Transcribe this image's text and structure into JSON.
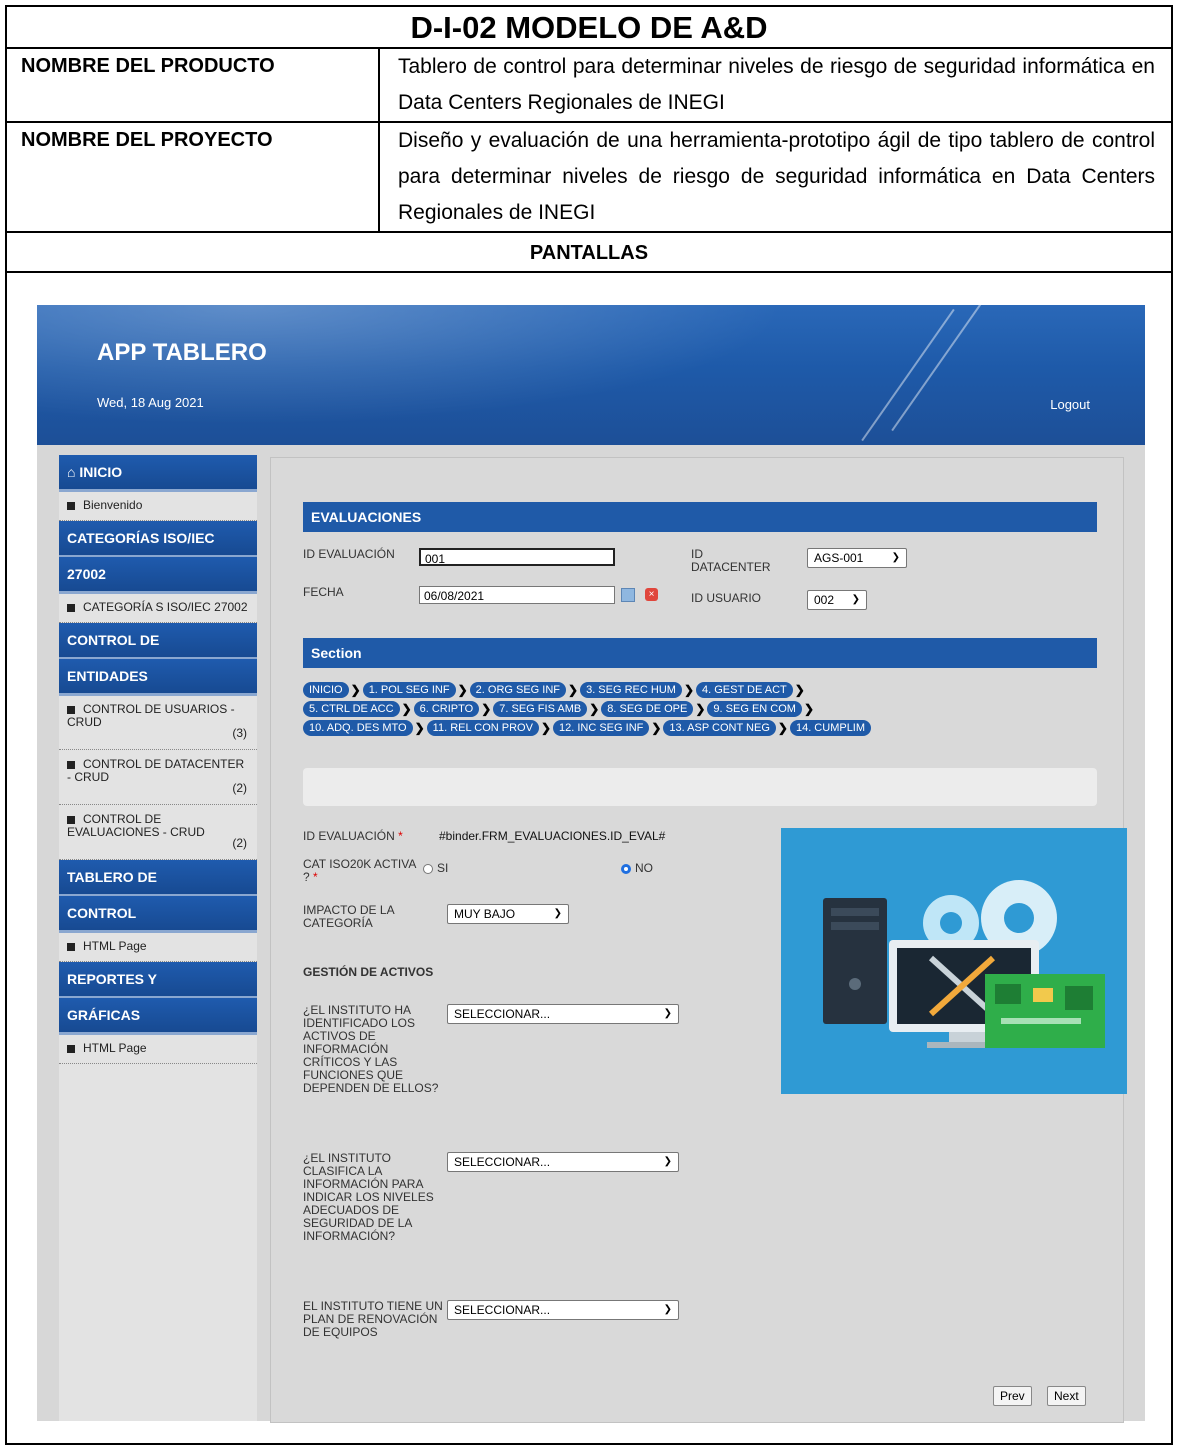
{
  "doc": {
    "title": "D-I-02 MODELO DE A&D",
    "rows": [
      {
        "label": "NOMBRE DEL PRODUCTO",
        "value": "Tablero de control para determinar niveles de riesgo de seguridad informática en Data Centers Regionales de INEGI"
      },
      {
        "label": "NOMBRE DEL PROYECTO",
        "value": "Diseño y evaluación de una herramienta-prototipo ágil de tipo tablero de control para determinar niveles de riesgo de seguridad informática en Data Centers Regionales de INEGI"
      }
    ],
    "section_heading": "PANTALLAS"
  },
  "app": {
    "title": "APP TABLERO",
    "date": "Wed, 18 Aug 2021",
    "logout": "Logout"
  },
  "sidebar": {
    "inicio": "INICIO",
    "bienvenido": "Bienvenido",
    "cat_h1": "CATEGORÍAS ISO/IEC",
    "cat_h2": "27002",
    "cat_item": "CATEGORÍA S ISO/IEC 27002",
    "ctrl_h1": "CONTROL DE",
    "ctrl_h2": "ENTIDADES",
    "ctrl_items": [
      {
        "label": "CONTROL DE USUARIOS - CRUD",
        "count": "(3)"
      },
      {
        "label": "CONTROL DE DATACENTER - CRUD",
        "count": "(2)"
      },
      {
        "label": "CONTROL DE EVALUACIONES - CRUD",
        "count": "(2)"
      }
    ],
    "tab_h1": "TABLERO DE",
    "tab_h2": "CONTROL",
    "tab_item": "HTML Page",
    "rep_h1": "REPORTES Y",
    "rep_h2": "GRÁFICAS",
    "rep_item": "HTML Page"
  },
  "form": {
    "section_title": "EVALUACIONES",
    "id_eval_label": "ID EVALUACIÓN",
    "id_eval_value": "001",
    "id_dc_label": "ID DATACENTER",
    "id_dc_value": "AGS-001",
    "fecha_label": "FECHA",
    "fecha_value": "06/08/2021",
    "id_user_label": "ID USUARIO",
    "id_user_value": "002",
    "section2_title": "Section",
    "crumbs": [
      [
        "INICIO",
        "1. POL SEG INF",
        "2. ORG SEG INF",
        "3. SEG REC HUM",
        "4. GEST DE ACT"
      ],
      [
        "5. CTRL DE ACC",
        "6. CRIPTO",
        "7. SEG FIS AMB",
        "8. SEG DE OPE",
        "9. SEG EN COM"
      ],
      [
        "10. ADQ. DES MTO",
        "11. REL CON PROV",
        "12. INC SEG INF",
        "13. ASP CONT NEG",
        "14. CUMPLIM"
      ]
    ],
    "id_eval2_label": "ID EVALUACIÓN",
    "id_eval2_value": "#binder.FRM_EVALUACIONES.ID_EVAL#",
    "cat_activa_label": "CAT ISO20K ACTIVA ?",
    "opt_si": "SI",
    "opt_no": "NO",
    "impacto_label": "IMPACTO DE LA CATEGORÍA",
    "impacto_value": "MUY BAJO",
    "gestion_title": "GESTIÓN DE ACTIVOS",
    "questions": [
      {
        "label": "¿EL INSTITUTO HA IDENTIFICADO LOS ACTIVOS DE INFORMACIÓN CRÍTICOS Y LAS FUNCIONES QUE DEPENDEN DE ELLOS?",
        "value": "SELECCIONAR..."
      },
      {
        "label": "¿EL INSTITUTO CLASIFICA LA INFORMACIÓN PARA INDICAR LOS NIVELES ADECUADOS DE SEGURIDAD DE LA INFORMACIÓN?",
        "value": "SELECCIONAR..."
      },
      {
        "label": "EL INSTITUTO TIENE UN PLAN DE RENOVACIÓN DE EQUIPOS",
        "value": "SELECCIONAR..."
      }
    ],
    "prev": "Prev",
    "next": "Next"
  }
}
